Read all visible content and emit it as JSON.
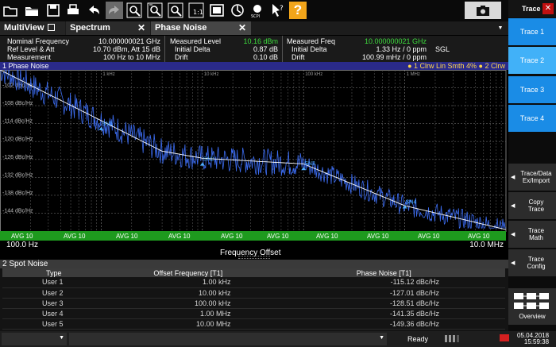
{
  "toolbar": {
    "icons": [
      "folder-open-icon",
      "folder-recent-icon",
      "save-icon",
      "print-icon",
      "undo-icon",
      "redo-icon",
      "zoom-icon",
      "zoom-multiple-icon",
      "zoom-area-icon",
      "zoom-off-icon",
      "display-config-icon",
      "sequencer-icon",
      "scpi-recorder-icon",
      "help-pointer-icon",
      "help-icon",
      "screenshot-icon"
    ],
    "help_label": "?"
  },
  "tabs": {
    "multiview": "MultiView",
    "spectrum": "Spectrum",
    "phase_noise": "Phase Noise",
    "close": "✕"
  },
  "info": {
    "nominal_freq_label": "Nominal Frequency",
    "nominal_freq_value": "10.000000021 GHz",
    "ref_level_label": "Ref Level & Att",
    "ref_level_value": "10.70 dBm, Att 15 dB",
    "measurement_label": "Measurement",
    "measurement_value": "100 Hz to 10 MHz",
    "meas_level_label": "Measured Level",
    "meas_level_value": "10.16 dBm",
    "init_delta1_label": "Initial Delta",
    "init_delta1_value": "0.87 dB",
    "drift1_label": "Drift",
    "drift1_value": "0.10 dB",
    "meas_freq_label": "Measured Freq",
    "meas_freq_value": "10.000000021 GHz",
    "init_delta2_label": "Initial Delta",
    "init_delta2_value": "1.33 Hz / 0 ppm",
    "drift2_label": "Drift",
    "drift2_value": "100.99 mHz / 0 ppm",
    "sgl": "SGL"
  },
  "phase_noise_window": {
    "title": "1 Phase Noise",
    "trace_info": "● 1 Clrw Lin Smth 4% ● 2 Clrw",
    "decade_labels": [
      "1 kHz",
      "10 kHz",
      "100 kHz",
      "1 MHz"
    ],
    "y_labels": [
      "-102 dBc/Hz",
      "-108 dBc/Hz",
      "-114 dBc/Hz",
      "-120 dBc/Hz",
      "-126 dBc/Hz",
      "-132 dBc/Hz",
      "-138 dBc/Hz",
      "-144 dBc/Hz"
    ],
    "markers": [
      "SN1",
      "SN2",
      "SN3",
      "SN4"
    ],
    "avg_label": "AVG 10",
    "x_start": "100.0 Hz",
    "x_stop": "10.0 MHz",
    "x_title": "Frequency Offset"
  },
  "spot_noise": {
    "title": "2 Spot Noise",
    "headers": [
      "Type",
      "Offset Frequency [T1]",
      "Phase Noise [T1]"
    ],
    "rows": [
      [
        "User 1",
        "1.00 kHz",
        "-115.12 dBc/Hz"
      ],
      [
        "User 2",
        "10.00 kHz",
        "-127.01 dBc/Hz"
      ],
      [
        "User 3",
        "100.00 kHz",
        "-128.51 dBc/Hz"
      ],
      [
        "User 4",
        "1.00 MHz",
        "-141.35 dBc/Hz"
      ],
      [
        "User 5",
        "10.00 MHz",
        "-149.36 dBc/Hz"
      ]
    ]
  },
  "status": {
    "ready": "Ready",
    "date": "05.04.2018",
    "time": "15:59:38"
  },
  "sidebar": {
    "header": "Trace",
    "close": "✕",
    "trace1": "Trace 1",
    "trace2": "Trace 2",
    "trace3": "Trace 3",
    "trace4": "Trace 4",
    "trace_data": "Trace/Data Ex/Import",
    "copy_trace": "Copy Trace",
    "trace_math": "Trace Math",
    "trace_config": "Trace Config",
    "overview": "Overview"
  },
  "colors": {
    "trace1": "#ffffff",
    "trace2": "#3c6cf0",
    "marker": "#4fb0ff",
    "avg_bar": "#1e9a1e",
    "accent": "#41b1f8"
  }
}
